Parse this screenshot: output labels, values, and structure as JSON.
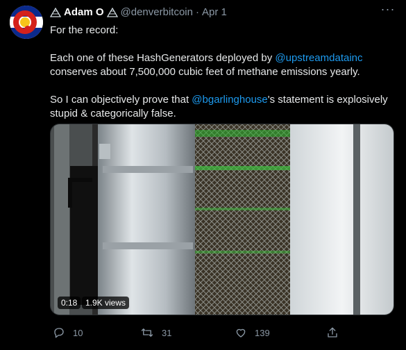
{
  "author": {
    "display_name": "Adam O",
    "handle": "@denverbitcoin",
    "separator": "·",
    "date": "Apr 1",
    "avatar_icon": "colorado-flag-avatar",
    "badge_icon": "mining-badge-icon"
  },
  "tweet": {
    "line1": "For the record:",
    "para2_before": "Each one of these HashGenerators deployed by ",
    "para2_mention": "@upstreamdatainc",
    "para2_after": " conserves about 7,500,000 cubic feet of methane emissions yearly.",
    "para3_before": "So I can objectively prove that ",
    "para3_mention": "@bgarlinghouse",
    "para3_after": "'s statement is explosively stupid & categorically false."
  },
  "media": {
    "duration": "0:18",
    "views": "1.9K views"
  },
  "actions": {
    "reply_count": "10",
    "retweet_count": "31",
    "like_count": "139"
  },
  "colors": {
    "background": "#000000",
    "text": "#e7e9ea",
    "muted": "#8b98a5",
    "link": "#1d9bf0"
  }
}
